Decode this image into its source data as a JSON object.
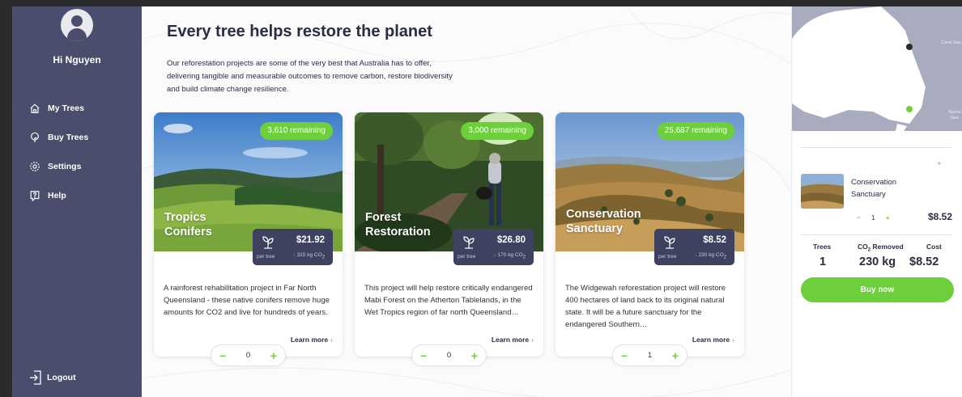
{
  "sidebar": {
    "username": "Hi Nguyen",
    "items": [
      {
        "label": "My Trees",
        "icon": "home-icon"
      },
      {
        "label": "Buy Trees",
        "icon": "tree-icon"
      },
      {
        "label": "Settings",
        "icon": "gear-icon"
      },
      {
        "label": "Help",
        "icon": "help-icon"
      }
    ],
    "logout_label": "Logout"
  },
  "main": {
    "title": "Every tree helps restore the planet",
    "description": "Our reforestation projects are some of the very best that Australia has to offer, delivering tangible and measurable outcomes to remove carbon, restore biodiversity and build climate change resilience."
  },
  "projects": [
    {
      "remaining": "3,610 remaining",
      "name": "Tropics Conifers",
      "price": "$21.92",
      "per_tree": "per tree",
      "co2": "315",
      "co2_unit": "kg CO",
      "description": "A rainforest rehabilitation project in Far North Queensland - these native conifers remove huge amounts for CO2 and live for hundreds of years.",
      "learn_more": "Learn more",
      "quantity": "0"
    },
    {
      "remaining": "3,000 remaining",
      "name": "Forest Restoration",
      "price": "$26.80",
      "per_tree": "per tree",
      "co2": "170",
      "co2_unit": "kg CO",
      "description": "This project will help restore critically endangered Mabi Forest on the Atherton Tablelands, in the Wet Tropics region of far north Queensland…",
      "learn_more": "Learn more",
      "quantity": "0"
    },
    {
      "remaining": "25,687 remaining",
      "name": "Conservation Sanctuary",
      "price": "$8.52",
      "per_tree": "per tree",
      "co2": "230",
      "co2_unit": "kg CO",
      "description": "The Widgewah reforestation project will restore 400 hectares of land back to its original natural state. It will be a future sanctuary for the endangered Southern…",
      "learn_more": "Learn more",
      "quantity": "1"
    }
  ],
  "map": {
    "coral_sea": "Coral Sea",
    "tasman_sea": "Tasma Sea"
  },
  "cart": {
    "item_name": "Conservation Sanctuary",
    "quantity": "1",
    "price": "$8.52",
    "stats": {
      "trees_label": "Trees",
      "co2_label_pre": "CO",
      "co2_label_post": " Removed",
      "cost_label": "Cost",
      "trees_value": "1",
      "co2_value": "230 kg",
      "cost_value": "$8.52"
    },
    "buy_label": "Buy now",
    "close_glyph": "×"
  },
  "colors": {
    "sidebar_bg": "#4a4d6b",
    "accent_green": "#6dcf3c",
    "price_box_bg": "#3e4160",
    "map_land": "#ffffff",
    "map_sea": "#a9acbf"
  }
}
